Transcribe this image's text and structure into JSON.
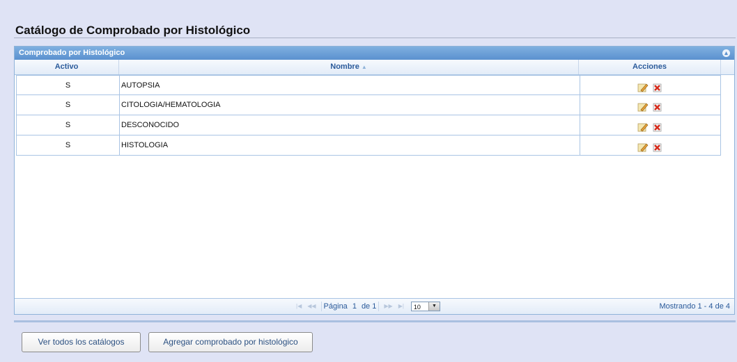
{
  "page": {
    "title": "Catálogo de Comprobado por Histológico"
  },
  "grid": {
    "caption": "Comprobado por Histológico",
    "columns": [
      "Activo",
      "Nombre",
      "Acciones"
    ],
    "rows": [
      {
        "activo": "S",
        "nombre": "AUTOPSIA"
      },
      {
        "activo": "S",
        "nombre": "CITOLOGIA/HEMATOLOGIA"
      },
      {
        "activo": "S",
        "nombre": "DESCONOCIDO"
      },
      {
        "activo": "S",
        "nombre": "HISTOLOGIA"
      }
    ],
    "row_actions": [
      "edit-icon",
      "delete-icon"
    ]
  },
  "pager": {
    "page_label": "Página",
    "page_value": "1",
    "of_label": "de",
    "total_pages": "1",
    "rows_per_page": "10",
    "info": "Mostrando 1 - 4 de 4"
  },
  "buttons": {
    "view_all": "Ver todos los catálogos",
    "add": "Agregar comprobado por histológico"
  },
  "colors": {
    "header_blue": "#5b91cf",
    "background": "#dfe3f5"
  }
}
